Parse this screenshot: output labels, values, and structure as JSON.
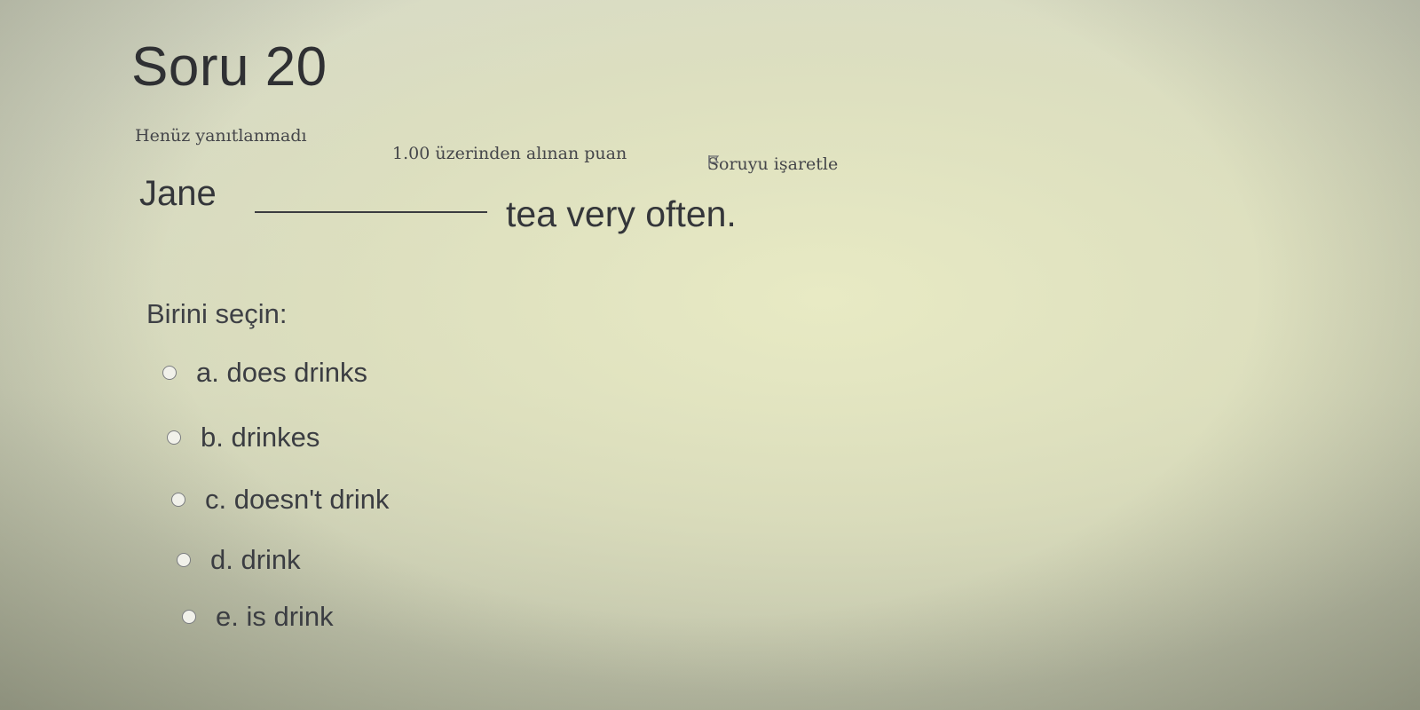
{
  "question": {
    "title": "Soru 20",
    "state": "Henüz yanıtlanmadı",
    "grade": "1.00 üzerinden alınan puan",
    "flag_label": "Soruyu işaretle",
    "text_subject": "Jane",
    "text_rest": "tea very often.",
    "prompt": "Birini seçin:",
    "answers": [
      {
        "label": "a. does drinks",
        "selected": false
      },
      {
        "label": "b. drinkes",
        "selected": false
      },
      {
        "label": "c. doesn't drink",
        "selected": false
      },
      {
        "label": "d. drink",
        "selected": false
      },
      {
        "label": "e. is drink",
        "selected": false
      }
    ]
  },
  "icons": {
    "flag": "flag-icon",
    "radio": "radio-unselected-icon"
  }
}
